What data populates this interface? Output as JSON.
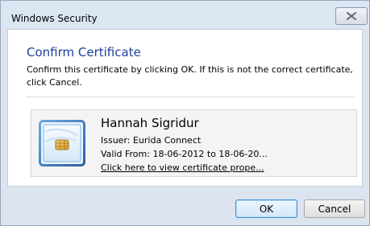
{
  "window": {
    "title": "Windows Security"
  },
  "dialog": {
    "heading": "Confirm Certificate",
    "description": "Confirm this certificate by clicking OK. If this is not the correct certificate, click Cancel."
  },
  "certificate": {
    "name": "Hannah Sigridur",
    "issuer": "Issuer: Eurida Connect",
    "valid_from": "Valid From: 18-06-2012 to 18-06-20...",
    "link": "Click here to view certificate prope..."
  },
  "buttons": {
    "ok": "OK",
    "cancel": "Cancel"
  },
  "icons": {
    "close": "close-icon",
    "certificate": "certificate-card-icon"
  }
}
